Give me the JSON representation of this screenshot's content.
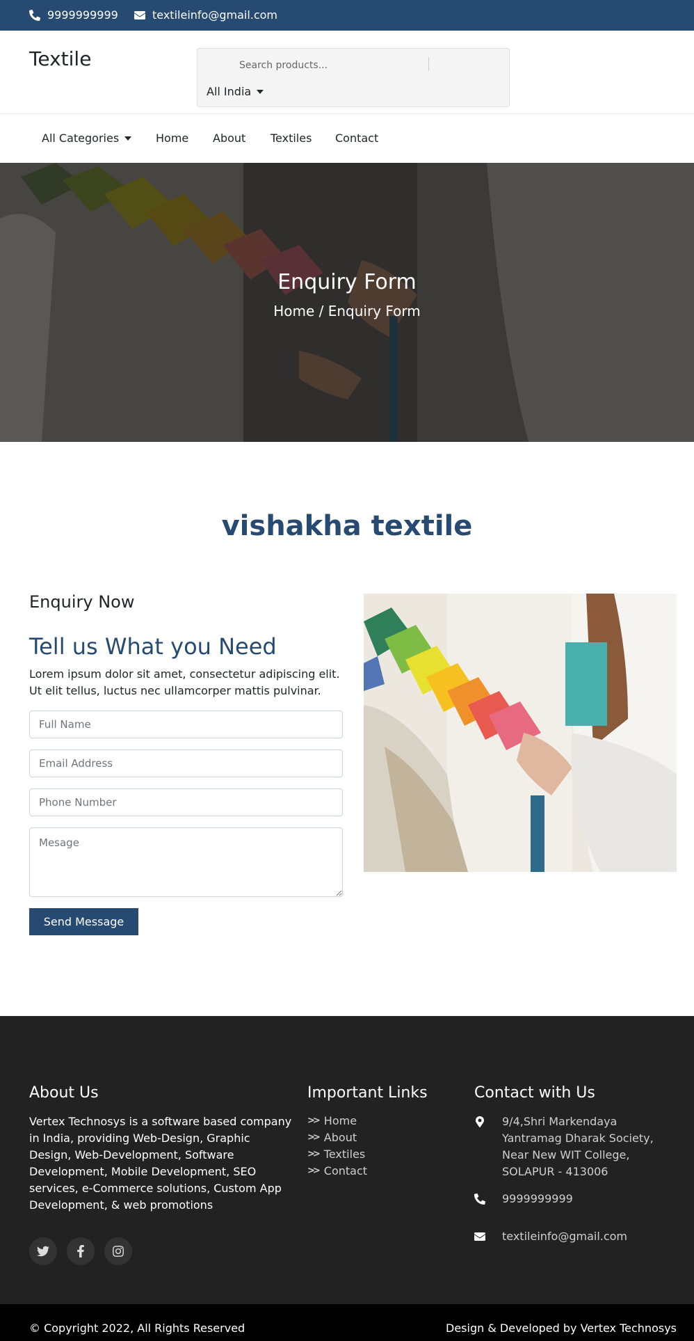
{
  "topbar": {
    "phone": "9999999999",
    "email": "textileinfo@gmail.com"
  },
  "header": {
    "logo": "Textile",
    "search_placeholder": "Search products...",
    "location": "All India"
  },
  "nav": {
    "categories": "All Categories",
    "items": [
      "Home",
      "About",
      "Textiles",
      "Contact"
    ]
  },
  "hero": {
    "title": "Enquiry Form",
    "breadcrumb": "Home / Enquiry Form"
  },
  "company_name": "vishakha textile",
  "enquiry": {
    "label": "Enquiry Now",
    "title": "Tell us What you Need",
    "description": "Lorem ipsum dolor sit amet, consectetur adipiscing elit. Ut elit tellus, luctus nec ullamcorper mattis pulvinar.",
    "fields": {
      "name": "Full Name",
      "email": "Email Address",
      "phone": "Phone Number",
      "message": "Mesage"
    },
    "button": "Send Message"
  },
  "footer": {
    "about_heading": "About Us",
    "about_text": "Vertex Technosys is a software based company in India, providing Web-Design, Graphic Design, Web-Development, Software Development, Mobile Development, SEO services, e-Commerce solutions, Custom App Development, & web promotions",
    "links_heading": "Important Links",
    "links": [
      "Home",
      "About",
      "Textiles",
      "Contact"
    ],
    "contact_heading": "Contact with Us",
    "address": "9/4,Shri Markendaya Yantramag Dharak Society, Near New WIT College, SOLAPUR - 413006",
    "phone": "9999999999",
    "email": "textileinfo@gmail.com"
  },
  "bottom": {
    "copyright": "© Copyright 2022, All Rights Reserved",
    "credit": "Design & Developed by Vertex Technosys"
  },
  "colors": {
    "brand": "#264a72",
    "footer_bg": "#222222",
    "bottom_bg": "#000000"
  },
  "icons": [
    "phone-icon",
    "envelope-icon",
    "caret-down-icon",
    "chevron-double-right-icon",
    "map-marker-icon",
    "twitter-icon",
    "facebook-icon",
    "instagram-icon"
  ]
}
